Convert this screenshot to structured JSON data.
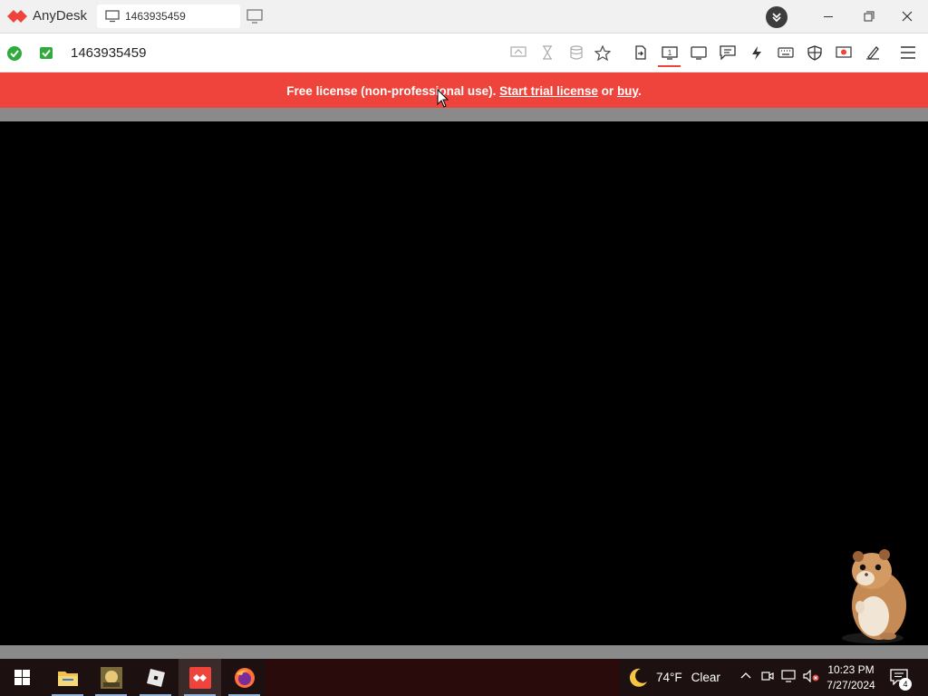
{
  "window": {
    "app_name": "AnyDesk",
    "tab_label": "1463935459"
  },
  "address_bar": {
    "session_id": "1463935459"
  },
  "toolbar": {
    "icons": [
      "screen-link-icon",
      "hourglass-icon",
      "database-icon",
      "favorite-star-icon",
      "file-transfer-icon",
      "monitor-switch-icon",
      "display-icon",
      "chat-icon",
      "actions-icon",
      "keyboard-icon",
      "permissions-icon",
      "record-icon",
      "whiteboard-icon",
      "menu-icon"
    ]
  },
  "banner": {
    "text_prefix": "Free license (non-professional use). ",
    "trial_link": "Start trial license",
    "text_mid": " or ",
    "buy_link": "buy",
    "text_suffix": "."
  },
  "taskbar": {
    "weather_temp": "74°F",
    "weather_desc": "Clear",
    "time": "10:23 PM",
    "date": "7/27/2024",
    "notification_count": "4"
  },
  "colors": {
    "brand_red": "#ef443b",
    "status_green": "#2faa3c"
  }
}
